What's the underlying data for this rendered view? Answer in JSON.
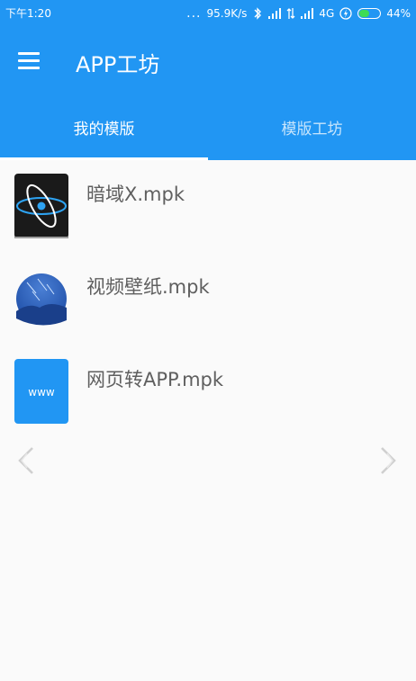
{
  "status_bar": {
    "time": "下午1:20",
    "dots": "...",
    "net_speed": "95.9K/s",
    "network": "4G",
    "battery": "44%"
  },
  "toolbar": {
    "title": "APP工坊"
  },
  "tabs": [
    {
      "label": "我的模版",
      "active": true
    },
    {
      "label": "模版工坊",
      "active": false
    }
  ],
  "files": [
    {
      "name": "暗域X.mpk",
      "icon": "orbit-icon"
    },
    {
      "name": "视频壁纸.mpk",
      "icon": "meteor-wallpaper-icon"
    },
    {
      "name": "网页转APP.mpk",
      "icon": "www-icon",
      "icon_text": "www"
    }
  ],
  "colors": {
    "primary": "#2196f3",
    "background": "#fafafa",
    "text": "#5f5f5f"
  }
}
